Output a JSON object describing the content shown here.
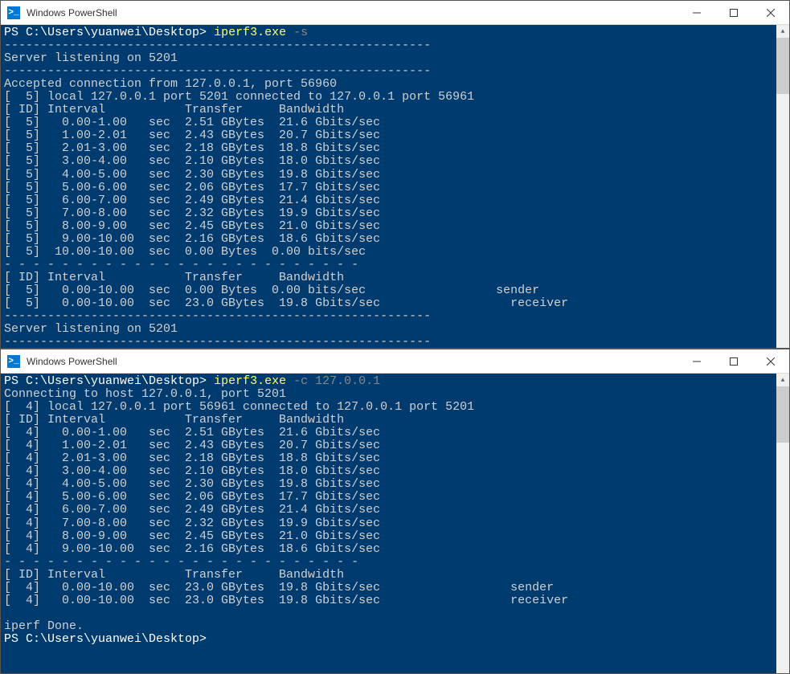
{
  "window1": {
    "title": "Windows PowerShell",
    "prompt": "PS C:\\Users\\yuanwei\\Desktop>",
    "cmd": "iperf3.exe",
    "cmd_args": "-s",
    "dash_line": "-----------------------------------------------------------",
    "listening1": "Server listening on 5201",
    "accepted": "Accepted connection from 127.0.0.1, port 56960",
    "local": "[  5] local 127.0.0.1 port 5201 connected to 127.0.0.1 port 56961",
    "header": "[ ID] Interval           Transfer     Bandwidth",
    "rows": [
      "[  5]   0.00-1.00   sec  2.51 GBytes  21.6 Gbits/sec",
      "[  5]   1.00-2.01   sec  2.43 GBytes  20.7 Gbits/sec",
      "[  5]   2.01-3.00   sec  2.18 GBytes  18.8 Gbits/sec",
      "[  5]   3.00-4.00   sec  2.10 GBytes  18.0 Gbits/sec",
      "[  5]   4.00-5.00   sec  2.30 GBytes  19.8 Gbits/sec",
      "[  5]   5.00-6.00   sec  2.06 GBytes  17.7 Gbits/sec",
      "[  5]   6.00-7.00   sec  2.49 GBytes  21.4 Gbits/sec",
      "[  5]   7.00-8.00   sec  2.32 GBytes  19.9 Gbits/sec",
      "[  5]   8.00-9.00   sec  2.45 GBytes  21.0 Gbits/sec",
      "[  5]   9.00-10.00  sec  2.16 GBytes  18.6 Gbits/sec",
      "[  5]  10.00-10.00  sec  0.00 Bytes  0.00 bits/sec"
    ],
    "dash_short": "- - - - - - - - - - - - - - - - - - - - - - - - -",
    "summary_header": "[ ID] Interval           Transfer     Bandwidth",
    "summary_rows": [
      "[  5]   0.00-10.00  sec  0.00 Bytes  0.00 bits/sec                  sender",
      "[  5]   0.00-10.00  sec  23.0 GBytes  19.8 Gbits/sec                  receiver"
    ],
    "listening2": "Server listening on 5201"
  },
  "window2": {
    "title": "Windows PowerShell",
    "prompt": "PS C:\\Users\\yuanwei\\Desktop>",
    "cmd": "iperf3.exe",
    "cmd_args": "-c 127.0.0.1",
    "connecting": "Connecting to host 127.0.0.1, port 5201",
    "local": "[  4] local 127.0.0.1 port 56961 connected to 127.0.0.1 port 5201",
    "header": "[ ID] Interval           Transfer     Bandwidth",
    "rows": [
      "[  4]   0.00-1.00   sec  2.51 GBytes  21.6 Gbits/sec",
      "[  4]   1.00-2.01   sec  2.43 GBytes  20.7 Gbits/sec",
      "[  4]   2.01-3.00   sec  2.18 GBytes  18.8 Gbits/sec",
      "[  4]   3.00-4.00   sec  2.10 GBytes  18.0 Gbits/sec",
      "[  4]   4.00-5.00   sec  2.30 GBytes  19.8 Gbits/sec",
      "[  4]   5.00-6.00   sec  2.06 GBytes  17.7 Gbits/sec",
      "[  4]   6.00-7.00   sec  2.49 GBytes  21.4 Gbits/sec",
      "[  4]   7.00-8.00   sec  2.32 GBytes  19.9 Gbits/sec",
      "[  4]   8.00-9.00   sec  2.45 GBytes  21.0 Gbits/sec",
      "[  4]   9.00-10.00  sec  2.16 GBytes  18.6 Gbits/sec"
    ],
    "dash_short": "- - - - - - - - - - - - - - - - - - - - - - - - -",
    "summary_header": "[ ID] Interval           Transfer     Bandwidth",
    "summary_rows": [
      "[  4]   0.00-10.00  sec  23.0 GBytes  19.8 Gbits/sec                  sender",
      "[  4]   0.00-10.00  sec  23.0 GBytes  19.8 Gbits/sec                  receiver"
    ],
    "done": "iperf Done.",
    "end_prompt": "PS C:\\Users\\yuanwei\\Desktop>"
  }
}
